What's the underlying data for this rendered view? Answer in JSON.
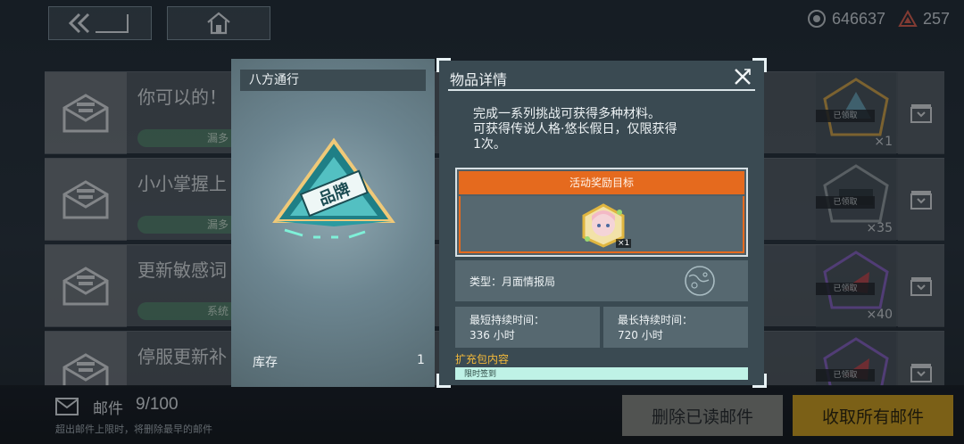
{
  "currencies": [
    {
      "icon": "eye-token-icon",
      "value": "646637"
    },
    {
      "icon": "triangle-token-icon",
      "value": "257"
    }
  ],
  "mails": [
    {
      "title": "你可以的！",
      "tag": "漏多",
      "reward_status": "已领取",
      "reward_qty": "×1"
    },
    {
      "title": "小小掌握上",
      "tag": "漏多",
      "reward_status": "已领取",
      "reward_qty": "×35"
    },
    {
      "title": "更新敏感词",
      "tag": "系统",
      "reward_status": "已领取",
      "reward_qty": "×40"
    },
    {
      "title": "停服更新补",
      "tag": "",
      "reward_status": "已领取",
      "reward_qty": ""
    }
  ],
  "bottom": {
    "mail_label": "邮件",
    "mail_count": "9/100",
    "note": "超出邮件上限时，将删除最早的邮件",
    "delete_read": "删除已读邮件",
    "claim_all": "收取所有邮件"
  },
  "item": {
    "name": "八方通行",
    "art_text": "品牌",
    "stock_label": "库存",
    "stock_value": "1"
  },
  "detail": {
    "title": "物品详情",
    "description_lines": [
      "完成一系列挑战可获得多种材料。",
      "可获得传说人格·悠长假日，仅限获得",
      "1次。"
    ],
    "goal_header": "活动奖励目标",
    "goal_qty": "×1",
    "type_label": "类型：月面情报局",
    "min_duration_label": "最短持续时间：",
    "min_duration_value": "336 小时",
    "max_duration_label": "最长持续时间：",
    "max_duration_value": "720 小时",
    "pack_label": "扩充包内容",
    "pack_item": "限时签到"
  },
  "colors": {
    "accent_orange": "#e56a1e",
    "claim_gold": "#d7a51c",
    "pack_label": "#f2b93a",
    "pack_item_bg": "#bff2e6"
  }
}
